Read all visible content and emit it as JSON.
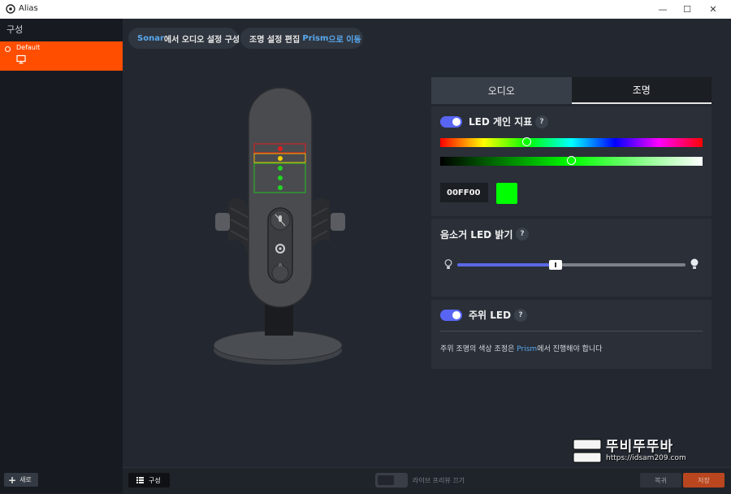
{
  "window": {
    "title": "Alias",
    "minimize": "—",
    "maximize": "☐",
    "close": "✕"
  },
  "sidebar": {
    "heading": "구성",
    "profile": {
      "name": "Default"
    },
    "new_button": "새로"
  },
  "top_buttons": {
    "sonar": {
      "highlight": "Sonar",
      "rest": "에서 오디오 설정 구성"
    },
    "prism": {
      "rest": "조명 설정 편집 ",
      "highlight": "Prism",
      "suffix": "으로 이동"
    }
  },
  "tabs": {
    "audio": "오디오",
    "lighting": "조명"
  },
  "led_gain": {
    "label": "LED 게인 지표",
    "help": "?",
    "enabled": true,
    "hue_position": 0.33,
    "shade_position": 0.5,
    "hex": "00FF00",
    "color": "#00ff00"
  },
  "mute_led": {
    "label": "음소거 LED 밝기",
    "help": "?",
    "brightness": 0.43
  },
  "ambient_led": {
    "label": "주위 LED",
    "help": "?",
    "enabled": true,
    "note": {
      "pre": "주위 조명의 색상 조정은 ",
      "link": "Prism",
      "post": "에서 진행해야 합니다"
    }
  },
  "bottom": {
    "config_button": "구성",
    "live_preview": "라이브 프리뷰 끄기",
    "revert": "복귀",
    "save": "저장"
  },
  "watermark": {
    "title": "뚜비뚜뚜바",
    "url": "https://idsam209.com"
  },
  "colors": {
    "accent": "#ff4e00",
    "toggle": "#5865f2",
    "link": "#59a9ef"
  }
}
